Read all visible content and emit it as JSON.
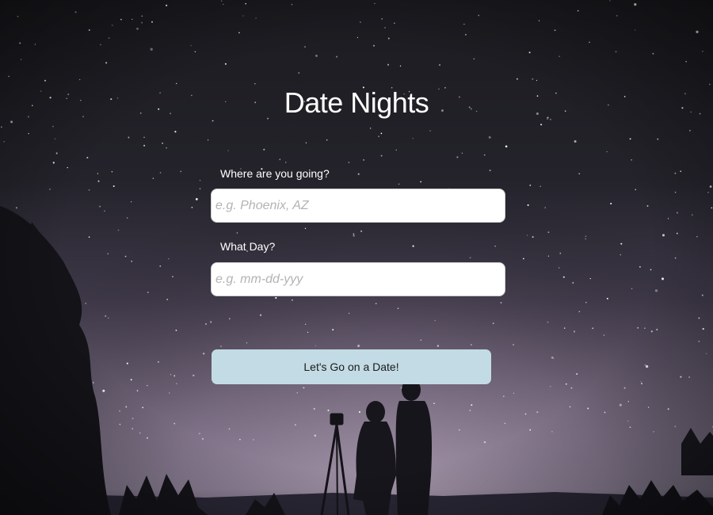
{
  "page": {
    "title": "Date Nights"
  },
  "form": {
    "destination": {
      "label": "Where are you going?",
      "placeholder": "e.g. Phoenix, AZ",
      "value": ""
    },
    "date": {
      "label": "What Day?",
      "placeholder": "e.g. mm-dd-yyy",
      "value": ""
    },
    "submit_label": "Let's Go on a Date!"
  },
  "colors": {
    "button_bg": "#c3dbe4",
    "text": "#ffffff",
    "sky_top": "#1a1a1f",
    "sky_glow": "#7a6a8a"
  },
  "background": {
    "description_icon": "starry-night-couple-photo"
  }
}
